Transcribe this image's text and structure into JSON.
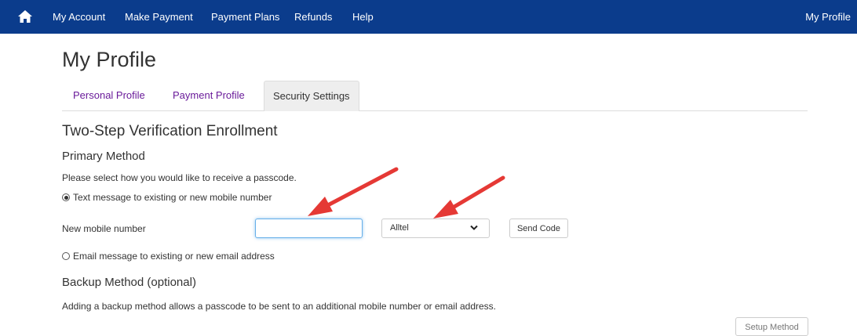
{
  "nav": {
    "items": [
      "My Account",
      "Make Payment",
      "Payment Plans",
      "Refunds",
      "Help"
    ],
    "right": "My Profile"
  },
  "page_title": "My Profile",
  "tabs": [
    {
      "label": "Personal Profile",
      "active": false
    },
    {
      "label": "Payment Profile",
      "active": false
    },
    {
      "label": "Security Settings",
      "active": true
    }
  ],
  "enrollment": {
    "title": "Two-Step Verification Enrollment",
    "primary_title": "Primary Method",
    "instruction": "Please select how you would like to receive a passcode.",
    "option_text": "Text message to existing or new mobile number",
    "option_email": "Email message to existing or new email address",
    "mobile_label": "New mobile number",
    "mobile_value": "",
    "carrier_selected": "Alltel",
    "send_code": "Send Code",
    "backup_title": "Backup Method (optional)",
    "backup_desc": "Adding a backup method allows a passcode to be sent to an additional mobile number or email address.",
    "setup_method": "Setup Method"
  },
  "colors": {
    "navbar": "#0b3c8c",
    "tab_link": "#6a1b9a",
    "annotation_arrow": "#e53935"
  },
  "icons": [
    "home-icon",
    "chevron-down-icon",
    "annotation-arrow"
  ]
}
